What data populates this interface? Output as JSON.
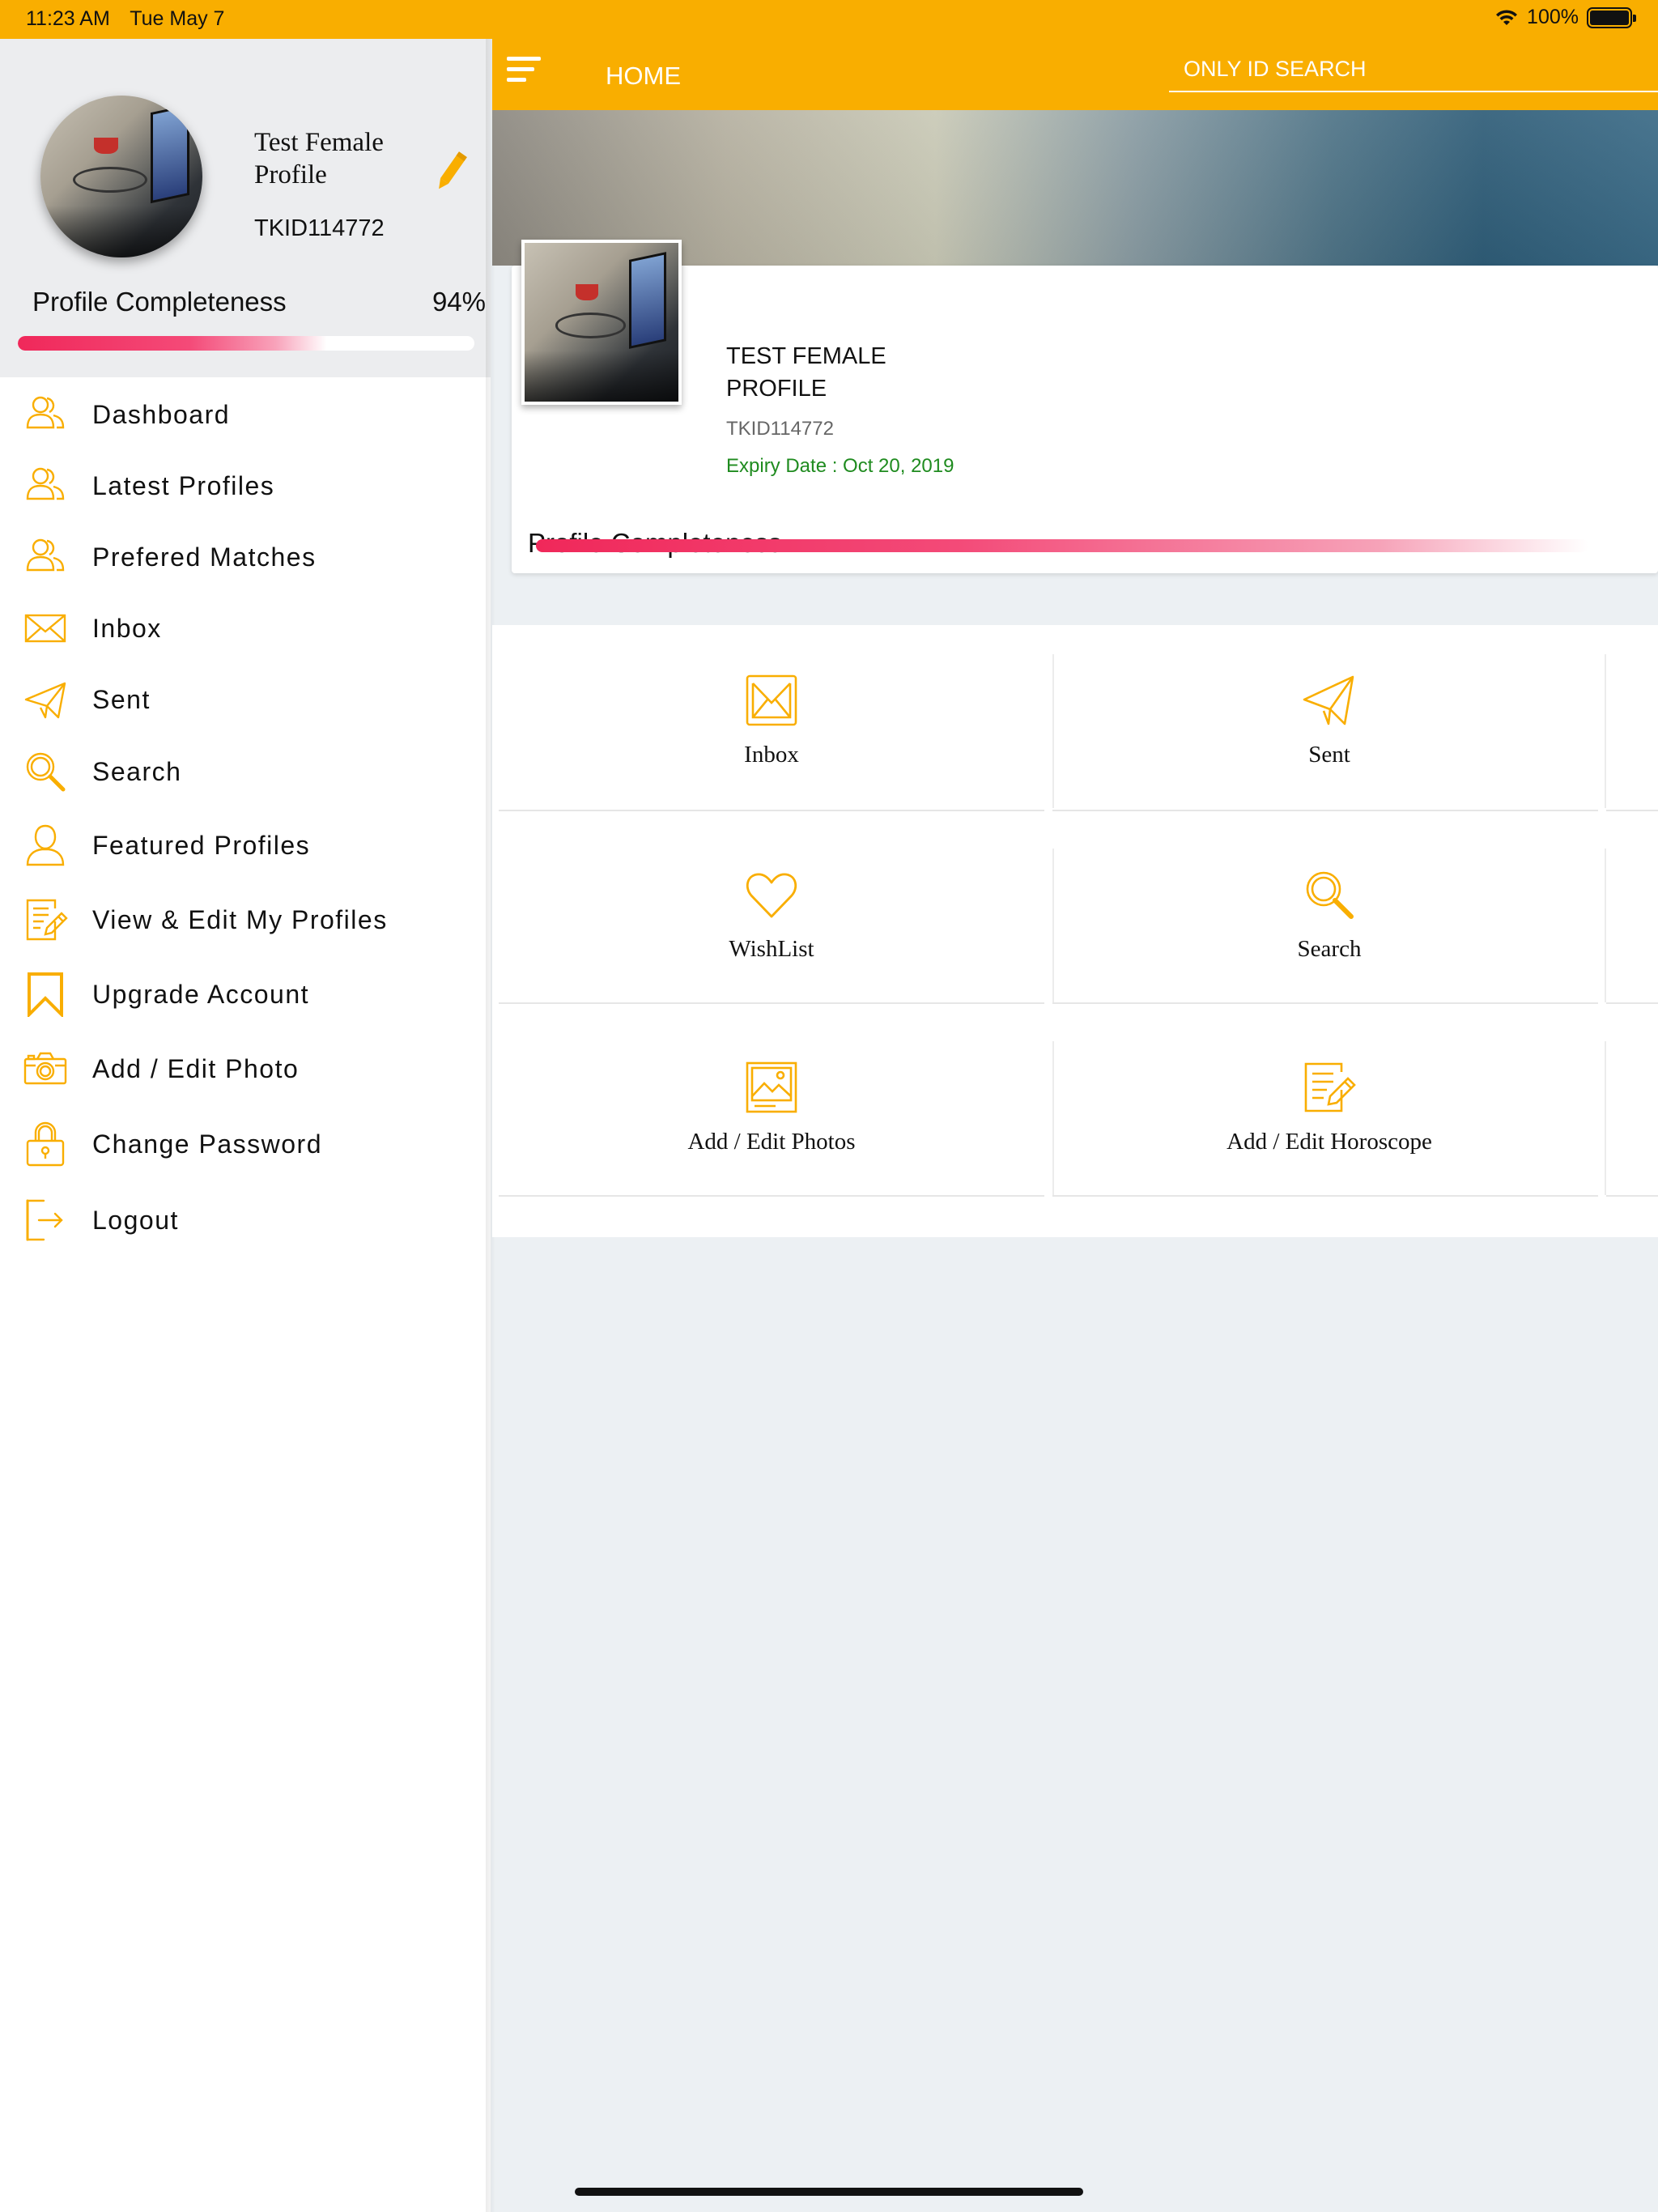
{
  "status_bar": {
    "time": "11:23 AM",
    "date": "Tue May 7",
    "battery": "100%",
    "battery_level": 1.0
  },
  "colors": {
    "accent": "#f9ae00",
    "progress": "#f0285a",
    "expiry": "#1f8b1f",
    "sidebar_header_bg": "#ecedef",
    "page_bg": "#ecf0f3"
  },
  "sidebar": {
    "profile_name": "Test Female Profile",
    "profile_id": "TKID114772",
    "edit_icon": "pencil-icon",
    "progress_label": "Profile Completeness",
    "progress_percent": "94%",
    "progress_value": 0.94,
    "items": [
      {
        "label": "Dashboard",
        "icon": "users-icon"
      },
      {
        "label": "Latest Profiles",
        "icon": "users-icon"
      },
      {
        "label": "Prefered Matches",
        "icon": "users-icon"
      },
      {
        "label": "Inbox",
        "icon": "envelope-icon"
      },
      {
        "label": "Sent",
        "icon": "paper-plane-icon"
      },
      {
        "label": "Search",
        "icon": "search-icon"
      },
      {
        "label": "Featured Profiles",
        "icon": "user-icon"
      },
      {
        "label": "View & Edit My Profiles",
        "icon": "edit-document-icon"
      },
      {
        "label": "Upgrade Account",
        "icon": "bookmark-icon"
      },
      {
        "label": "Add / Edit Photo",
        "icon": "camera-icon"
      },
      {
        "label": "Change Password",
        "icon": "lock-icon"
      },
      {
        "label": "Logout",
        "icon": "logout-icon"
      }
    ]
  },
  "topbar": {
    "menu_icon": "hamburger-icon",
    "title": "HOME",
    "search_placeholder": "ONLY ID SEARCH"
  },
  "profile_card": {
    "name": "TEST FEMALE PROFILE",
    "id": "TKID114772",
    "expiry": "Expiry Date : Oct 20, 2019",
    "progress_label": "Profile Completeness",
    "progress_value": 0.94
  },
  "tiles": [
    {
      "label": "Inbox",
      "icon": "envelope-icon"
    },
    {
      "label": "Sent",
      "icon": "paper-plane-icon"
    },
    {
      "label": "WishList",
      "icon": "heart-icon"
    },
    {
      "label": "Search",
      "icon": "search-icon"
    },
    {
      "label": "Add / Edit Photos",
      "icon": "image-icon"
    },
    {
      "label": "Add / Edit Horoscope",
      "icon": "edit-document-icon"
    }
  ]
}
